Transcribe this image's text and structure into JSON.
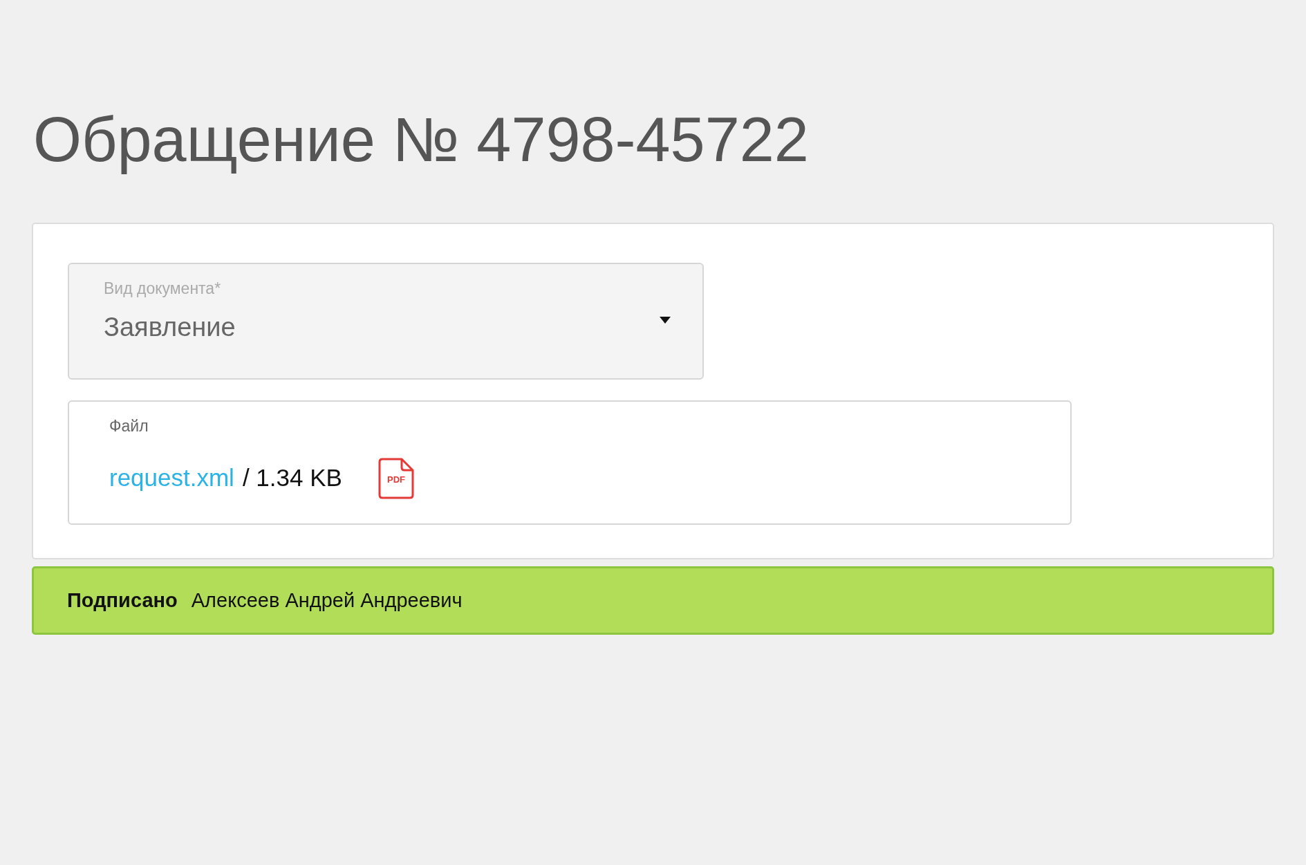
{
  "title": "Обращение № 4798-45722",
  "document_type": {
    "label": "Вид документа*",
    "value": "Заявление"
  },
  "file": {
    "label": "Файл",
    "name": "request.xml",
    "size": "/ 1.34 KB",
    "icon_label": "PDF"
  },
  "signature": {
    "status": "Подписано",
    "signer": "Алексеев Андрей Андреевич",
    "signed": true
  }
}
